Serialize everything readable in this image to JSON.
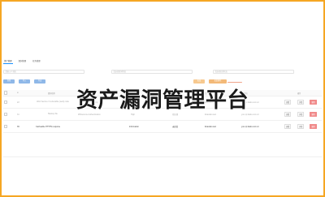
{
  "tabs": [
    "资产管理",
    "漏洞管理",
    "任务管理"
  ],
  "filters": {
    "f1_placeholder": "请输入IP/域名",
    "f2_placeholder": "请选择漏洞等级",
    "f3_placeholder": "请选择处理状态"
  },
  "toolbar": {
    "b1": "新增",
    "b2": "导入",
    "b3": "导出",
    "b4": "批量",
    "b5": "批量删除"
  },
  "table": {
    "headers": [
      "",
      "ID",
      "漏洞名称",
      "漏洞类型",
      "等级",
      "状态",
      "负责人",
      "资产地址",
      "",
      "操作"
    ],
    "rows": [
      {
        "id": "22",
        "name": "Web Service 3 vulnerable (web) code",
        "type": "WSDD vulnerability",
        "level": "High",
        "status": "待处理",
        "owner": "lixiaodan.test",
        "asset": "yun.cp.baidu.com.cn",
        "edit": "查看",
        "view": "详情",
        "del": "删除"
      },
      {
        "id": "31",
        "name": "Backup file",
        "type": "Whitescore Authentication",
        "level": "High",
        "status": "待处理",
        "owner": "lixiaodan.test",
        "asset": "yun.cp.baidu.com.cn",
        "edit": "查看",
        "view": "详情",
        "del": "删除"
      },
      {
        "id": "39",
        "name": "Cacheable HTTPS response",
        "type": "",
        "level": "Information",
        "status": "未修复",
        "owner": "lixiaodan.test",
        "asset": "yun.cp.baidu.com.cn",
        "edit": "查看",
        "view": "详情",
        "del": "删除"
      }
    ]
  },
  "overlay_title": "资产漏洞管理平台",
  "colors": {
    "frame": "#f5a623",
    "primary": "#8fb8e8",
    "warn": "#f7c98f",
    "danger": "#f08a8a"
  }
}
